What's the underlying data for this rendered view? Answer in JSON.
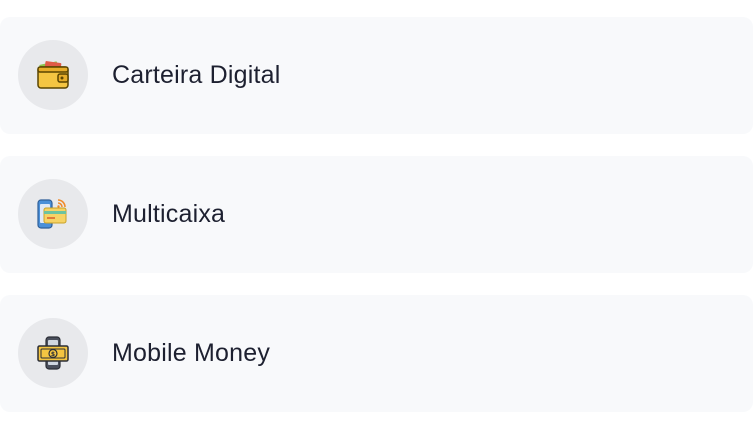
{
  "payment_methods": [
    {
      "label": "Carteira Digital",
      "icon": "wallet-icon"
    },
    {
      "label": "Multicaixa",
      "icon": "card-nfc-icon"
    },
    {
      "label": "Mobile Money",
      "icon": "mobile-money-icon"
    }
  ],
  "colors": {
    "row_background": "#f8f9fb",
    "icon_circle": "#e8e9ec",
    "text": "#1d2030",
    "wallet_yellow": "#f4c542",
    "card_blue": "#4a90d9",
    "nfc_orange": "#f08a2a"
  }
}
